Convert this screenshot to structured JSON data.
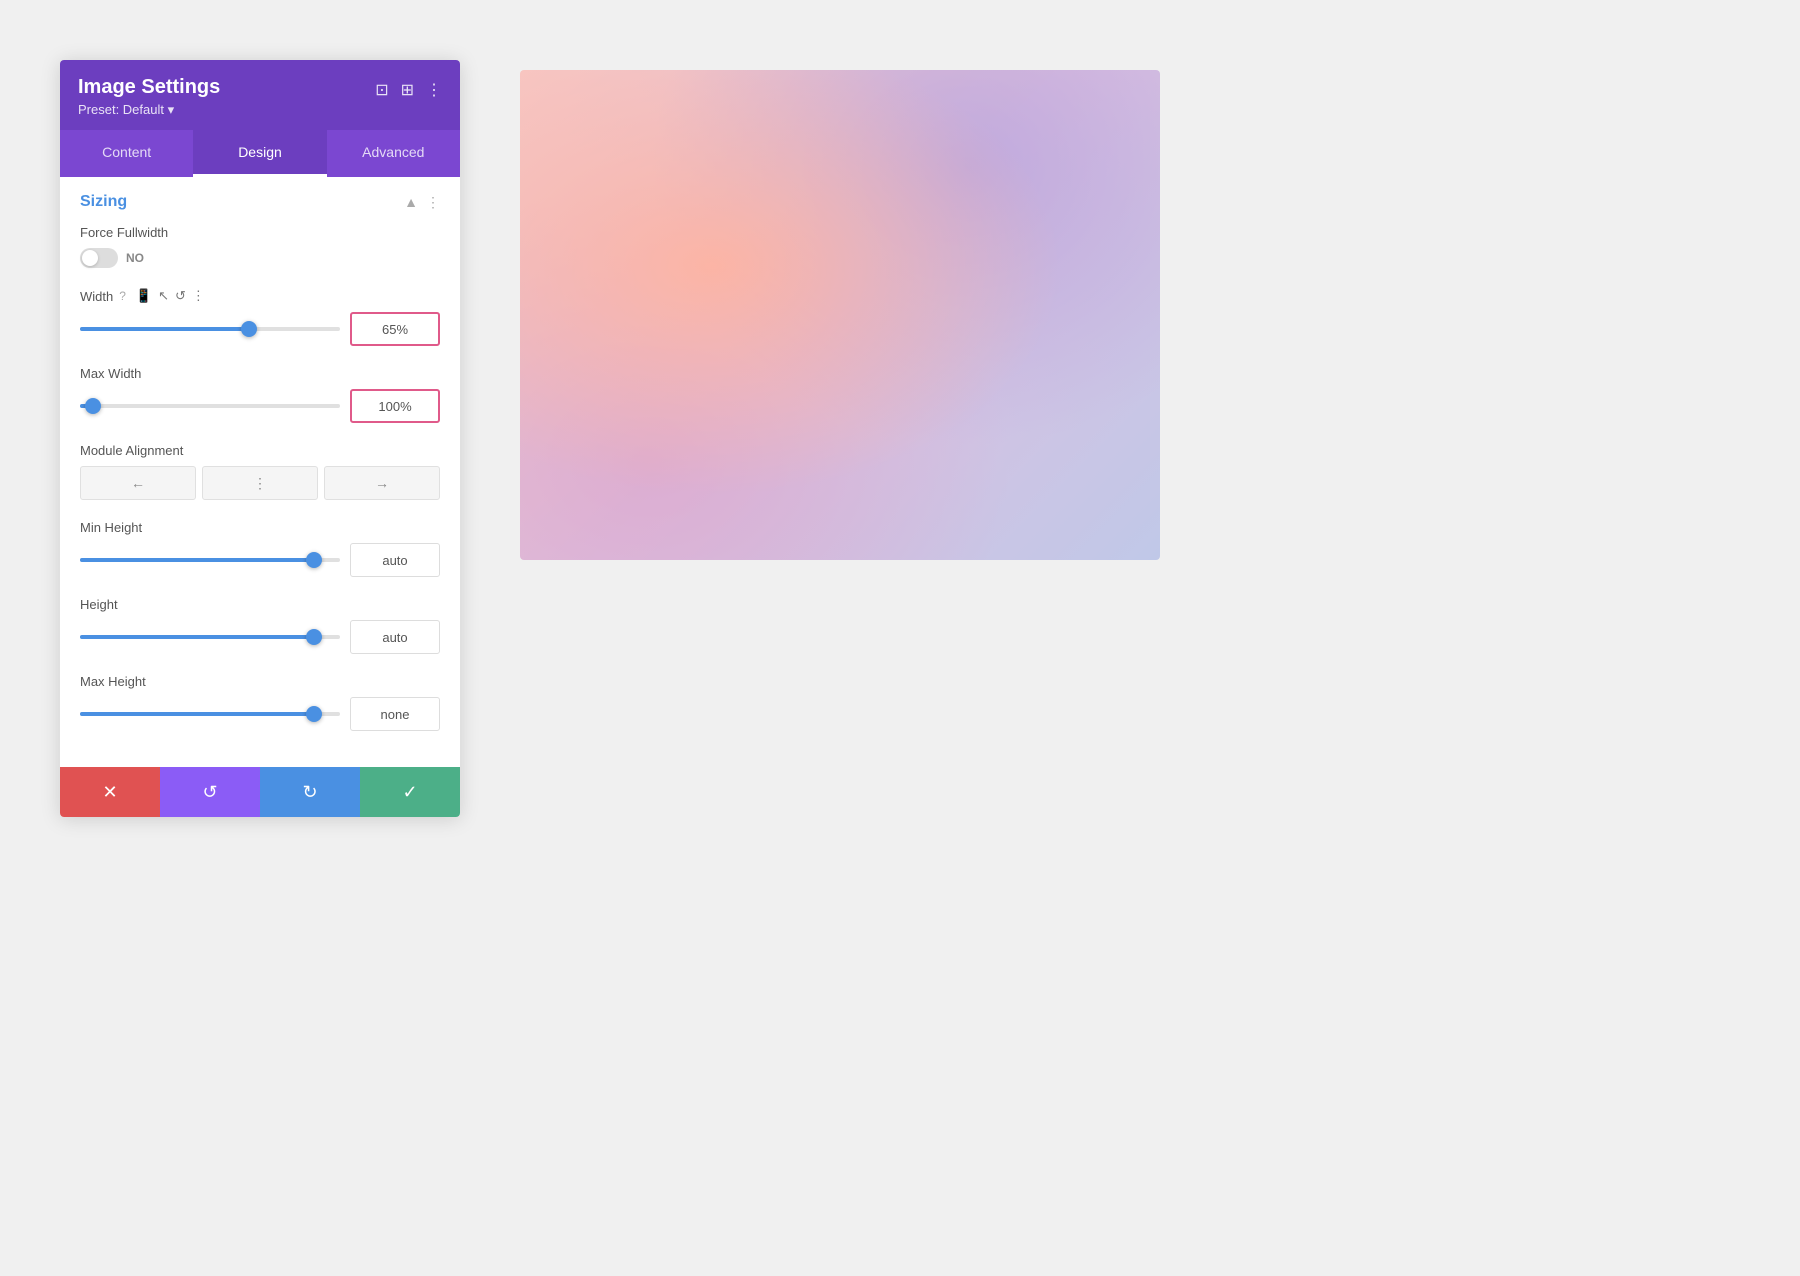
{
  "panel": {
    "title": "Image Settings",
    "preset": "Preset: Default ▾",
    "tabs": [
      {
        "id": "content",
        "label": "Content",
        "active": false
      },
      {
        "id": "design",
        "label": "Design",
        "active": true
      },
      {
        "id": "advanced",
        "label": "Advanced",
        "active": false
      }
    ]
  },
  "sizing": {
    "section_title": "Sizing",
    "force_fullwidth": {
      "label": "Force Fullwidth",
      "toggle_state": "NO"
    },
    "width": {
      "label": "Width",
      "value": "65%",
      "thumb_pct": 65
    },
    "max_width": {
      "label": "Max Width",
      "value": "100%",
      "thumb_pct": 5
    },
    "module_alignment": {
      "label": "Module Alignment",
      "options": [
        "left",
        "center",
        "right"
      ]
    },
    "min_height": {
      "label": "Min Height",
      "value": "auto",
      "thumb_pct": 90
    },
    "height": {
      "label": "Height",
      "value": "auto",
      "thumb_pct": 90
    },
    "max_height": {
      "label": "Max Height",
      "value": "none",
      "thumb_pct": 90
    }
  },
  "footer": {
    "cancel_label": "✕",
    "undo_label": "↺",
    "redo_label": "↻",
    "save_label": "✓"
  }
}
